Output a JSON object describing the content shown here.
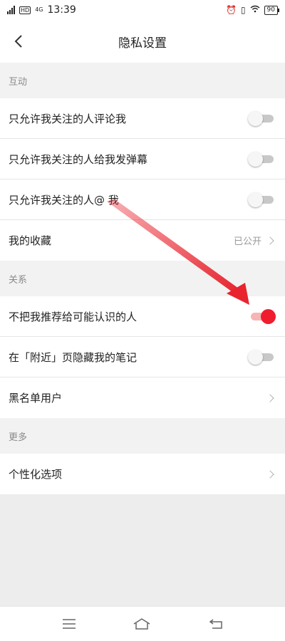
{
  "status_bar": {
    "network": "4G",
    "hd": "HD",
    "time": "13:39",
    "battery": "90",
    "icons": [
      "alarm-icon",
      "vibrate-icon",
      "wifi-icon"
    ]
  },
  "header": {
    "title": "隐私设置",
    "back_icon": "chevron-left-icon"
  },
  "sections": [
    {
      "title": "互动",
      "items": [
        {
          "label": "只允许我关注的人评论我",
          "type": "toggle",
          "on": false
        },
        {
          "label": "只允许我关注的人给我发弹幕",
          "type": "toggle",
          "on": false
        },
        {
          "label": "只允许我关注的人@ 我",
          "type": "toggle",
          "on": false
        },
        {
          "label": "我的收藏",
          "type": "link",
          "value": "已公开"
        }
      ]
    },
    {
      "title": "关系",
      "items": [
        {
          "label": "不把我推荐给可能认识的人",
          "type": "toggle",
          "on": true
        },
        {
          "label": "在「附近」页隐藏我的笔记",
          "type": "toggle",
          "on": false
        },
        {
          "label": "黑名单用户",
          "type": "link"
        }
      ]
    },
    {
      "title": "更多",
      "items": [
        {
          "label": "个性化选项",
          "type": "link"
        }
      ]
    }
  ],
  "bottom_nav": [
    "menu-icon",
    "home-icon",
    "back-icon"
  ],
  "colors": {
    "toggle_on_knob": "#ef1d2e",
    "toggle_on_track": "#f6b5b5",
    "toggle_off_knob": "#f6f6f6",
    "toggle_off_track": "#c8c8c8",
    "annotation_arrow": "#e8242e"
  }
}
